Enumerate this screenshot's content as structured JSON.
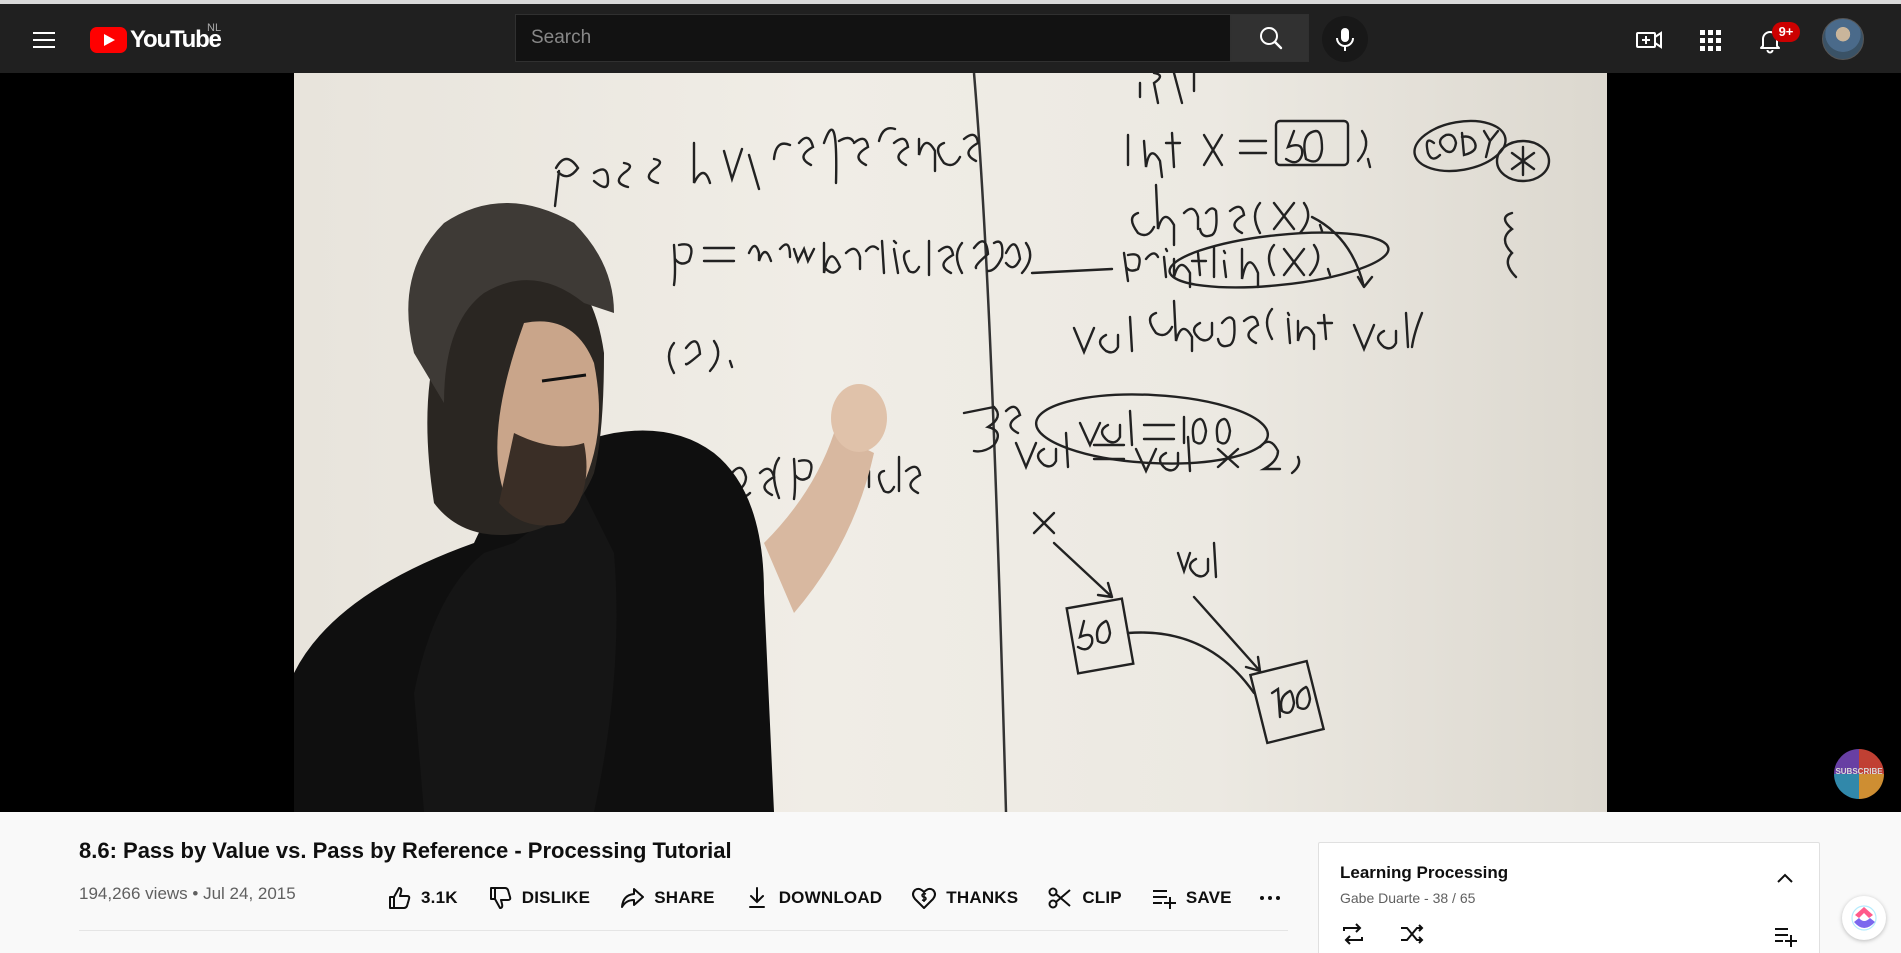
{
  "masthead": {
    "logo_text": "YouTube",
    "country_code": "NL",
    "search": {
      "placeholder": "Search"
    },
    "notifications_badge": "9+",
    "icons": [
      "menu-icon",
      "search-icon",
      "mic-icon",
      "create-video-icon",
      "apps-icon",
      "bell-icon",
      "avatar"
    ]
  },
  "player": {
    "watermark_label": "SUBSCRIBE"
  },
  "video": {
    "title": "8.6: Pass by Value vs. Pass by Reference - Processing Tutorial",
    "meta": "194,266 views • Jul 24, 2015"
  },
  "actions": {
    "like": "3.1K",
    "dislike": "DISLIKE",
    "share": "SHARE",
    "download": "DOWNLOAD",
    "thanks": "THANKS",
    "clip": "CLIP",
    "save": "SAVE"
  },
  "playlist": {
    "title": "Learning Processing",
    "subtitle": "Gabe Duarte - 38 / 65"
  },
  "colors": {
    "masthead_bg": "#202020",
    "brand_red": "#ff0000",
    "badge_red": "#cc0000",
    "page_bg": "#f9f9f9"
  }
}
